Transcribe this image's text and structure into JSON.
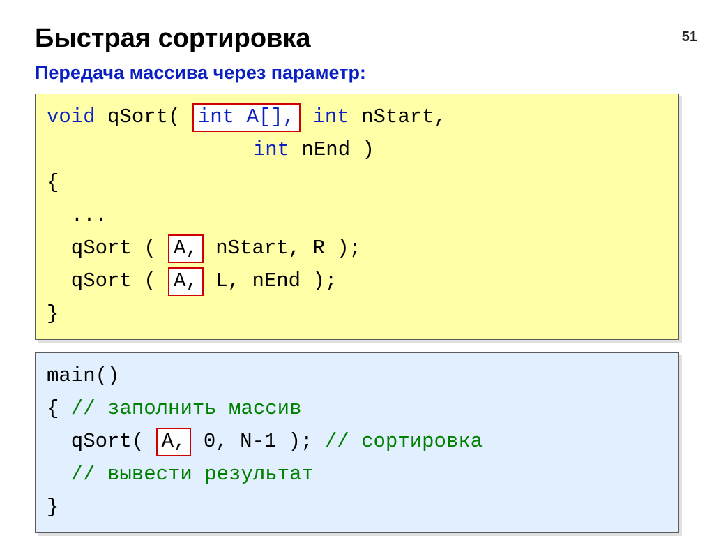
{
  "page_number": "51",
  "title": "Быстрая сортировка",
  "subtitle": "Передача массива через параметр:",
  "code1": {
    "l1a": "void",
    "l1b": " qSort( ",
    "l1hl": "int A[],",
    "l1c": " ",
    "l1d": "int",
    "l1e": " nStart,",
    "l2a": "                 ",
    "l2b": "int",
    "l2c": " nEnd )",
    "l3": "{",
    "l4": "  ...",
    "l5a": "  qSort ( ",
    "l5hl": "A,",
    "l5b": " nStart, R );",
    "l6a": "  qSort ( ",
    "l6hl": "A,",
    "l6b": " L, nEnd );",
    "l7": "}"
  },
  "code2": {
    "l1": "main()",
    "l2a": "{ ",
    "l2b": "// заполнить массив",
    "l3a": "  qSort( ",
    "l3hl": "A,",
    "l3b": " 0, N-1 ); ",
    "l3c": "// сортировка",
    "l4": "  // вывести результат",
    "l5": "}"
  }
}
